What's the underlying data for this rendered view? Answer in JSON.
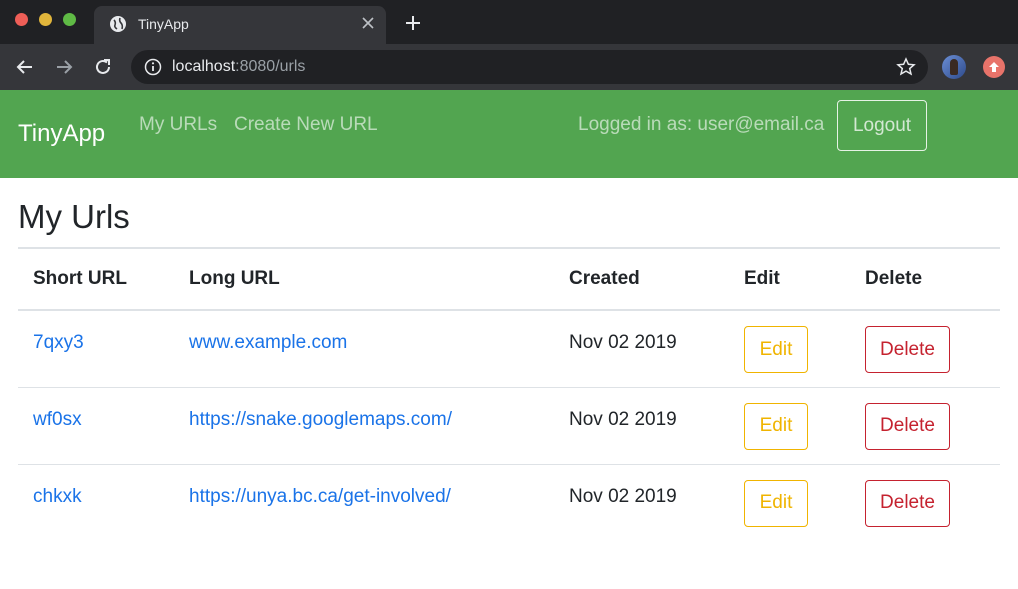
{
  "browser": {
    "tab_title": "TinyApp",
    "url_host": "localhost",
    "url_rest": ":8080/urls"
  },
  "navbar": {
    "brand": "TinyApp",
    "links": [
      "My URLs",
      "Create New URL"
    ],
    "logged_in_text": "Logged in as: user@email.ca",
    "logout_label": "Logout",
    "bg_color": "#52a550"
  },
  "page": {
    "title": "My Urls"
  },
  "table": {
    "headers": [
      "Short URL",
      "Long URL",
      "Created",
      "Edit",
      "Delete"
    ],
    "rows": [
      {
        "short": "7qxy3",
        "long": "www.example.com",
        "created": "Nov 02 2019",
        "edit": "Edit",
        "delete": "Delete"
      },
      {
        "short": "wf0sx",
        "long": "https://snake.googlemaps.com/",
        "created": "Nov 02 2019",
        "edit": "Edit",
        "delete": "Delete"
      },
      {
        "short": "chkxk",
        "long": "https://unya.bc.ca/get-involved/",
        "created": "Nov 02 2019",
        "edit": "Edit",
        "delete": "Delete"
      }
    ]
  },
  "colors": {
    "link": "#1a73e8",
    "edit": "#f0b400",
    "delete": "#c5222f"
  }
}
